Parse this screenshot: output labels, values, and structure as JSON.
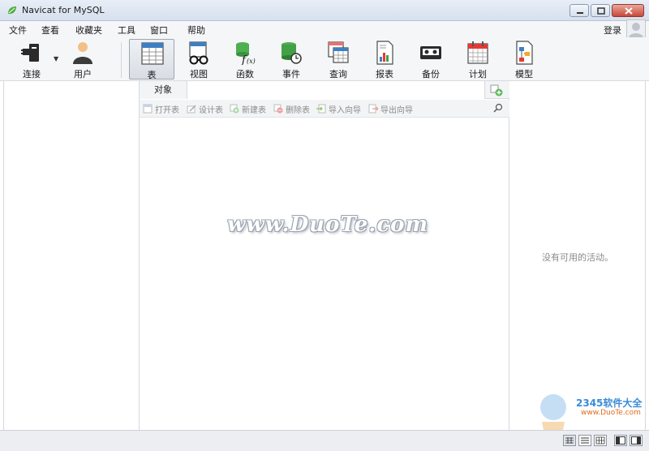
{
  "window": {
    "title": "Navicat for MySQL"
  },
  "menu": [
    "文件",
    "查看",
    "收藏夹",
    "工具",
    "窗口",
    "帮助"
  ],
  "login_label": "登录",
  "toolbar": {
    "connect": "连接",
    "user": "用户",
    "table": "表",
    "view": "视图",
    "function": "函数",
    "event": "事件",
    "query": "查询",
    "report": "报表",
    "backup": "备份",
    "schedule": "计划",
    "model": "模型"
  },
  "object_tab": {
    "label": "对象",
    "field_value": ""
  },
  "object_toolbar": {
    "open_table": "打开表",
    "design_table": "设计表",
    "new_table": "新建表",
    "delete_table": "删除表",
    "import_wizard": "导入向导",
    "export_wizard": "导出向导"
  },
  "right_pane": {
    "empty_text": "没有可用的活动。"
  },
  "watermark": {
    "text": "www.DuoTe.com",
    "logo_text": "2345软件大全",
    "logo_sub": "www.DuoTe.com"
  }
}
